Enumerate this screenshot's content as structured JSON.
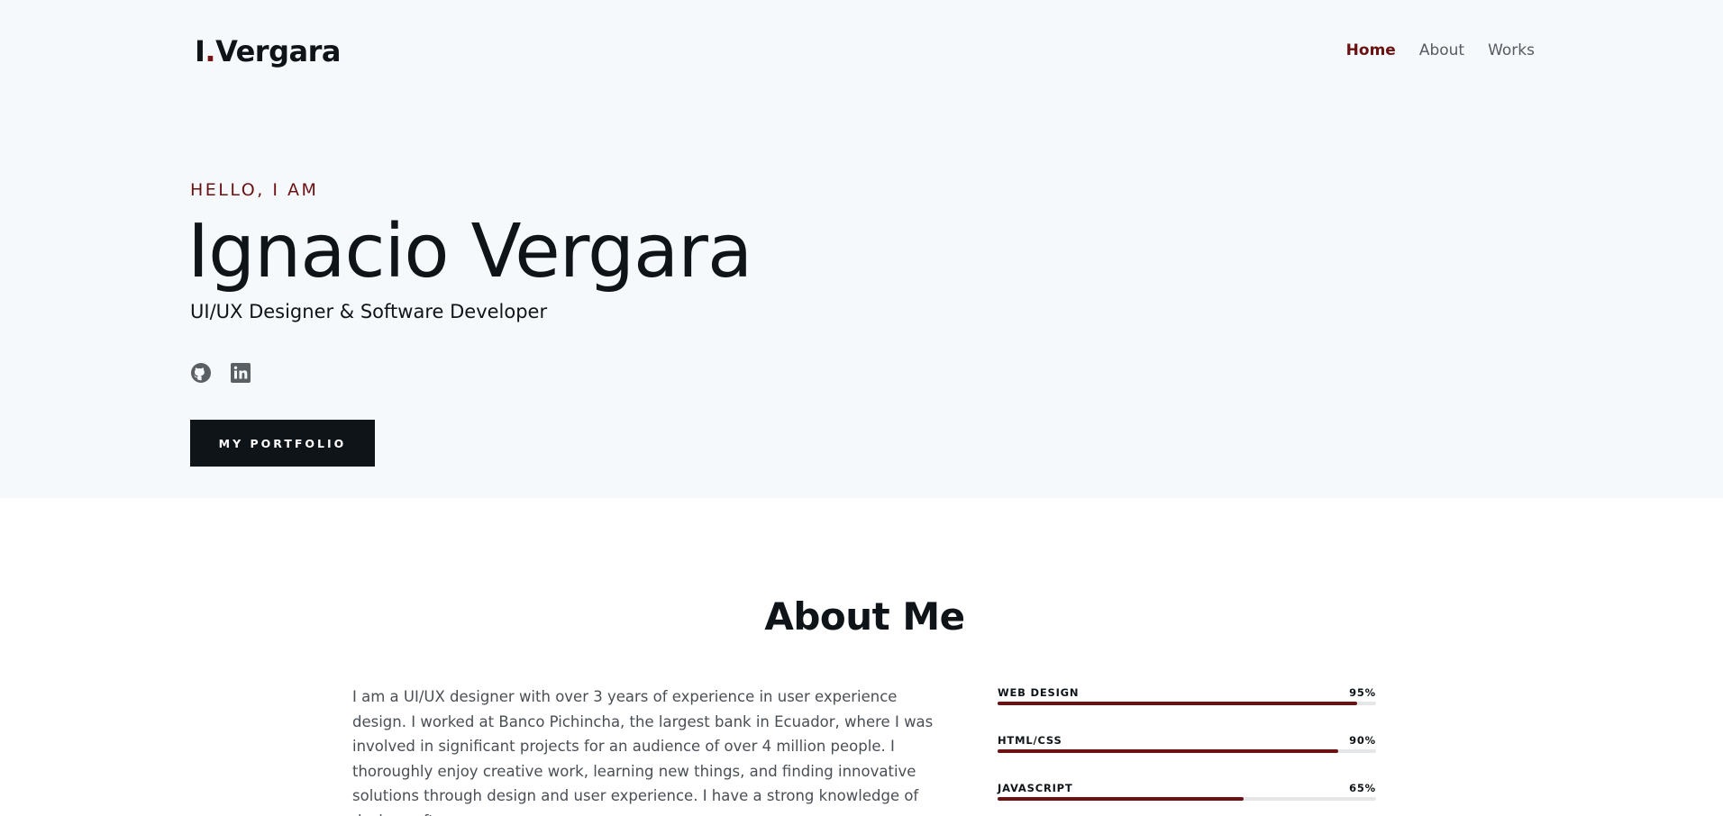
{
  "header": {
    "logo_initial": "I",
    "logo_dot": ".",
    "logo_name": "Vergara",
    "nav": [
      "Home",
      "About",
      "Works"
    ],
    "active_nav": "Home"
  },
  "hero": {
    "greeting": "HELLO, I AM",
    "name": "Ignacio Vergara",
    "role": "UI/UX Designer & Software Developer",
    "socials": [
      "github-icon",
      "linkedin-icon"
    ],
    "button_label": "MY PORTFOLIO"
  },
  "about": {
    "title": "About Me",
    "paragraph": "I am a UI/UX designer with over 3 years of experience in user experience design. I worked at Banco Pichincha, the largest bank in Ecuador, where I was involved in significant projects for an audience of over 4 million people. I thoroughly enjoy creative work, learning new things, and finding innovative solutions through design and user experience. I have a strong knowledge of design software,"
  },
  "skills": [
    {
      "name": "WEB DESIGN",
      "percent_label": "95%",
      "level": 0.95
    },
    {
      "name": "HTML/CSS",
      "percent_label": "90%",
      "level": 0.9
    },
    {
      "name": "JAVASCRIPT",
      "percent_label": "65%",
      "level": 0.65
    }
  ],
  "colors": {
    "accent": "#6b1111",
    "dark": "#0f1419",
    "hero_bg": "#f6f9fc"
  }
}
